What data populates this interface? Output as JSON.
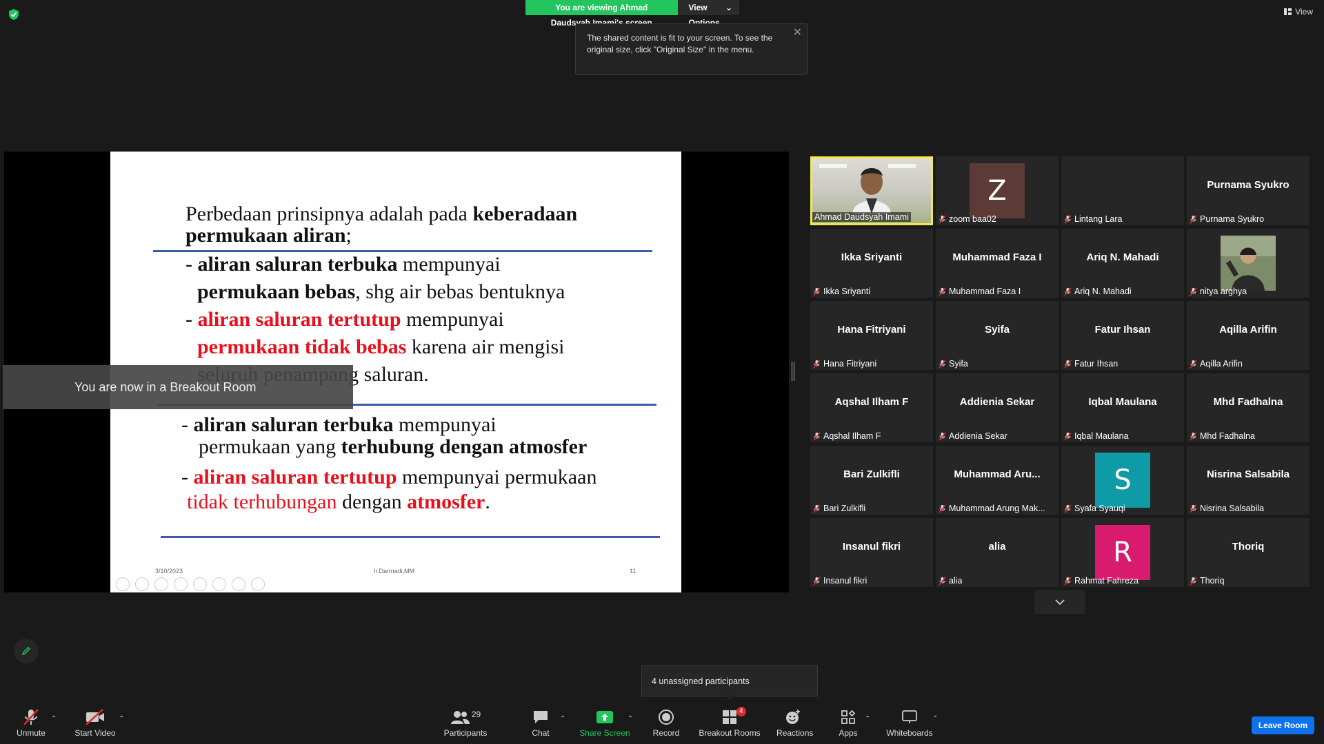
{
  "top": {
    "viewing_banner": "You are viewing Ahmad Daudsyah Imami's screen",
    "view_options": "View Options",
    "view_label": "View",
    "tooltip": "The shared content is fit to your screen. To see the original size, click \"Original Size\" in the menu."
  },
  "slide": {
    "l1a": "Perbedaan prinsipnya adalah pada ",
    "l1b": "keberadaan",
    "l2a": "permukaan aliran",
    "l2b": ";",
    "l3a": "- ",
    "l3b": "aliran saluran terbuka",
    "l3c": " mempunyai",
    "l4a": "permukaan bebas",
    "l4b": ", shg air bebas bentuknya",
    "l5a": "- ",
    "l5b": "aliran saluran tertutup",
    "l5c": " mempunyai",
    "l6a": "permukaan tidak bebas",
    "l6b": " karena air mengisi",
    "l7": "seluruh penampang saluran.",
    "l8a": "-  ",
    "l8b": "aliran saluran terbuka",
    "l8c": " mempunyai",
    "l9a": "permukaan yang ",
    "l9b": "terhubung dengan atmosfer",
    "l10a": "-  ",
    "l10b": "aliran saluran tertutup",
    "l10c": " mempunyai permukaan",
    "l11a": "tidak terhubungan",
    "l11b": "  dengan  ",
    "l11c": "atmosfer",
    "l11d": ".",
    "footer_date": "3/10/2023",
    "footer_author": "Ir.Darmadi,MM",
    "footer_page": "11"
  },
  "breakout_notice": "You are now in a Breakout Room",
  "gallery": [
    {
      "name": "",
      "label": "Ahmad Daudsyah Imami",
      "muted": false,
      "kind": "video"
    },
    {
      "name": "",
      "label": "zoom baa02",
      "muted": true,
      "kind": "avatar",
      "letter": "Z",
      "color": "#5c3a35"
    },
    {
      "name": "",
      "label": "Lintang Lara",
      "muted": true,
      "kind": "blank"
    },
    {
      "name": "Purnama Syukro",
      "label": "Purnama Syukro",
      "muted": true,
      "kind": "name"
    },
    {
      "name": "Ikka Sriyanti",
      "label": "Ikka Sriyanti",
      "muted": true,
      "kind": "name"
    },
    {
      "name": "Muhammad Faza I",
      "label": "Muhammad Faza I",
      "muted": true,
      "kind": "name"
    },
    {
      "name": "Ariq N. Mahadi",
      "label": "Ariq N. Mahadi",
      "muted": true,
      "kind": "name"
    },
    {
      "name": "",
      "label": "nitya arghya",
      "muted": true,
      "kind": "photo"
    },
    {
      "name": "Hana Fitriyani",
      "label": "Hana Fitriyani",
      "muted": true,
      "kind": "name"
    },
    {
      "name": "Syifa",
      "label": "Syifa",
      "muted": true,
      "kind": "name"
    },
    {
      "name": "Fatur Ihsan",
      "label": "Fatur Ihsan",
      "muted": true,
      "kind": "name"
    },
    {
      "name": "Aqilla Arifin",
      "label": "Aqilla Arifin",
      "muted": true,
      "kind": "name"
    },
    {
      "name": "Aqshal Ilham F",
      "label": "Aqshal Ilham F",
      "muted": true,
      "kind": "name"
    },
    {
      "name": "Addienia Sekar",
      "label": "Addienia Sekar",
      "muted": true,
      "kind": "name"
    },
    {
      "name": "Iqbal Maulana",
      "label": "Iqbal Maulana",
      "muted": true,
      "kind": "name"
    },
    {
      "name": "Mhd Fadhalna",
      "label": "Mhd Fadhalna",
      "muted": true,
      "kind": "name"
    },
    {
      "name": "Bari Zulkifli",
      "label": "Bari Zulkifli",
      "muted": true,
      "kind": "name"
    },
    {
      "name": "Muhammad  Aru...",
      "label": "Muhammad Arung Mak...",
      "muted": true,
      "kind": "name"
    },
    {
      "name": "",
      "label": "Syafa Syauqi",
      "muted": true,
      "kind": "avatar",
      "letter": "S",
      "color": "#0e9aa7"
    },
    {
      "name": "Nisrina Salsabila",
      "label": "Nisrina Salsabila",
      "muted": true,
      "kind": "name"
    },
    {
      "name": "Insanul fikri",
      "label": "Insanul fikri",
      "muted": true,
      "kind": "name"
    },
    {
      "name": "alia",
      "label": "alia",
      "muted": true,
      "kind": "name"
    },
    {
      "name": "",
      "label": "Rahmat Fahreza",
      "muted": true,
      "kind": "avatar",
      "letter": "R",
      "color": "#d81b6f"
    },
    {
      "name": "Thoriq",
      "label": "Thoriq",
      "muted": true,
      "kind": "name"
    }
  ],
  "unassigned": "4 unassigned participants",
  "toolbar": {
    "unmute": "Unmute",
    "start_video": "Start Video",
    "participants": "Participants",
    "participants_count": "29",
    "chat": "Chat",
    "share_screen": "Share Screen",
    "record": "Record",
    "breakout_rooms": "Breakout Rooms",
    "breakout_badge": "4",
    "reactions": "Reactions",
    "apps": "Apps",
    "whiteboards": "Whiteboards",
    "leave_room": "Leave Room"
  },
  "colors": {
    "banner_green": "#22c55e",
    "share_green": "#22c55e",
    "leave_blue": "#0e72ed",
    "slide_red": "#e8101c",
    "slide_rule_blue": "#3b5ca8",
    "active_speaker": "#f4e94a"
  }
}
